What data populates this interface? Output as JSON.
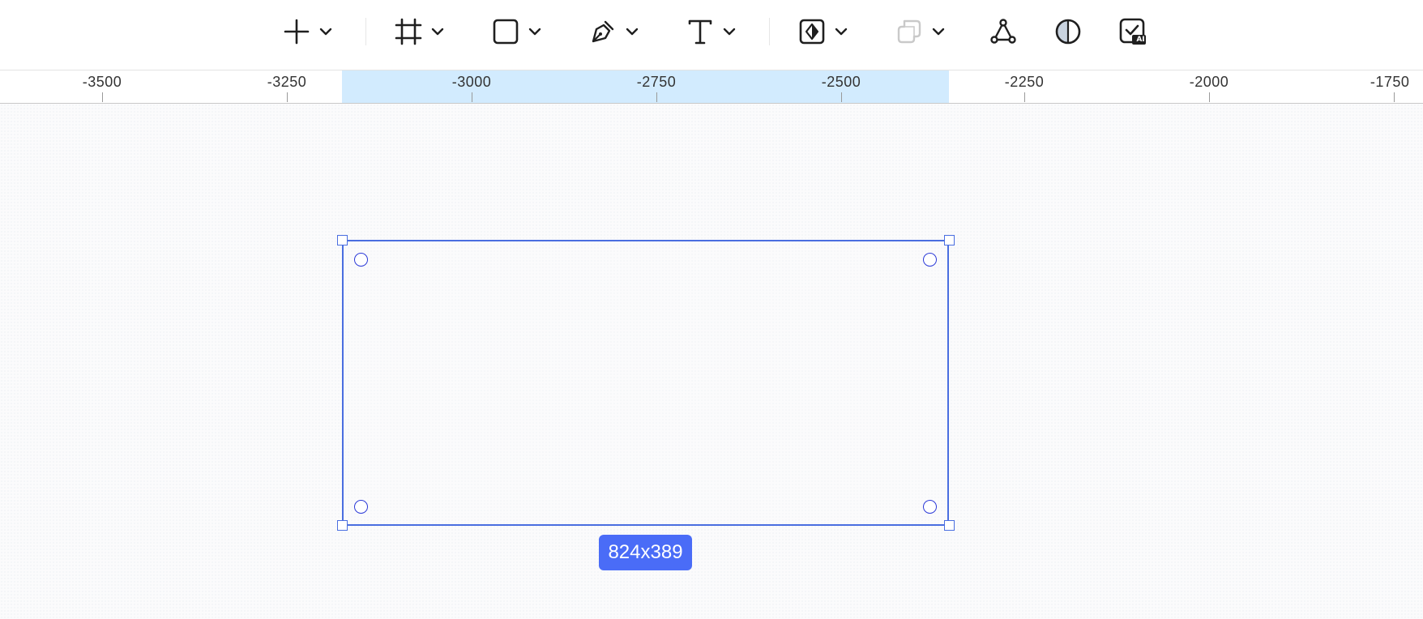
{
  "toolbar": {
    "tools": [
      {
        "name": "add",
        "icon": "plus-icon",
        "has_menu": true
      },
      {
        "name": "frame",
        "icon": "frame-icon",
        "has_menu": true
      },
      {
        "name": "rectangle",
        "icon": "rectangle-icon",
        "has_menu": true
      },
      {
        "name": "pen",
        "icon": "pen-icon",
        "has_menu": true
      },
      {
        "name": "text",
        "icon": "text-icon",
        "has_menu": true
      },
      {
        "name": "component",
        "icon": "component-icon",
        "has_menu": true
      },
      {
        "name": "boolean",
        "icon": "boolean-icon",
        "has_menu": true,
        "disabled": true
      },
      {
        "name": "vector-network",
        "icon": "vector-network-icon",
        "has_menu": false
      },
      {
        "name": "contrast",
        "icon": "contrast-icon",
        "has_menu": false
      },
      {
        "name": "ai-check",
        "icon": "ai-check-icon",
        "badge": "AI",
        "has_menu": false
      }
    ],
    "icon_color": "#1f1f1f",
    "disabled_color": "#c9c9c9"
  },
  "ruler": {
    "labels": [
      "-3500",
      "-3250",
      "-3000",
      "-2750",
      "-2500",
      "-2250",
      "-2000",
      "-1750"
    ],
    "highlight_color": "#d2ebfe"
  },
  "selection": {
    "size_label": "824x389",
    "stroke_color": "#4a6ee0",
    "badge_color": "#4a6cf7"
  }
}
